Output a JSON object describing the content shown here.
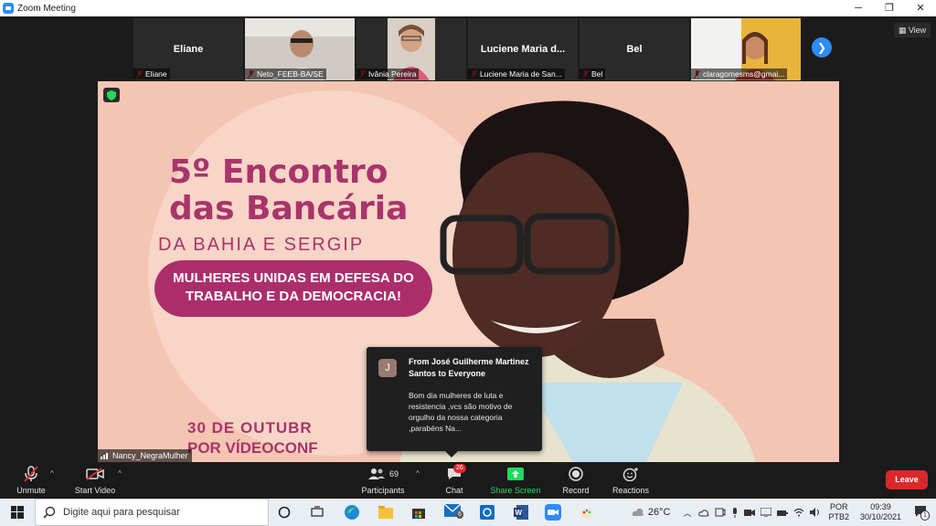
{
  "window": {
    "title": "Zoom Meeting"
  },
  "view_label": "View",
  "participants_strip": [
    {
      "big_name": "Eliane",
      "label": "Eliane",
      "has_video": false
    },
    {
      "big_name": "",
      "label": "Neto_FEEB-BA/SE",
      "has_video": true
    },
    {
      "big_name": "",
      "label": "Ivânia Pereira",
      "has_video": true
    },
    {
      "big_name": "Luciene  Maria  d...",
      "label": "Luciene Maria de San...",
      "has_video": false
    },
    {
      "big_name": "Bel",
      "label": "Bel",
      "has_video": false
    },
    {
      "big_name": "",
      "label": "claragomesms@gmai...",
      "has_video": true
    }
  ],
  "poster": {
    "line1": "5º Encontro",
    "line2": "das Bancária",
    "line3": "DA BAHIA E SERGIP",
    "banner": "MULHERES UNIDAS EM DEFESA DO\nTRABALHO E DA DEMOCRACIA!",
    "date1": "30 DE OUTUBR",
    "date2": "POR VÍDEOCONF"
  },
  "speaker_name": "Nancy_NegraMulher",
  "chat_popup": {
    "avatar_letter": "J",
    "from": "From José Guilherme Martinez Santos to Everyone",
    "message": "Bom dia mulheres de luta e resistencia ,vcs são motivo de orgulho da nossa categoria ,parabéns Na..."
  },
  "toolbar": {
    "unmute": "Unmute",
    "start_video": "Start Video",
    "participants": "Participants",
    "participants_count": "69",
    "chat": "Chat",
    "chat_badge": "26",
    "share_screen": "Share Screen",
    "record": "Record",
    "reactions": "Reactions",
    "leave": "Leave"
  },
  "taskbar": {
    "search_placeholder": "Digite aqui para pesquisar",
    "weather": "26°C",
    "lang1": "POR",
    "lang2": "PTB2",
    "time": "09:39",
    "date": "30/10/2021",
    "mail_badge": "6",
    "notif_count": "1"
  },
  "colors": {
    "zoom_blue": "#2d8cff",
    "share_green": "#23d959",
    "leave_red": "#d9282b",
    "poster_magenta": "#a8346b"
  }
}
